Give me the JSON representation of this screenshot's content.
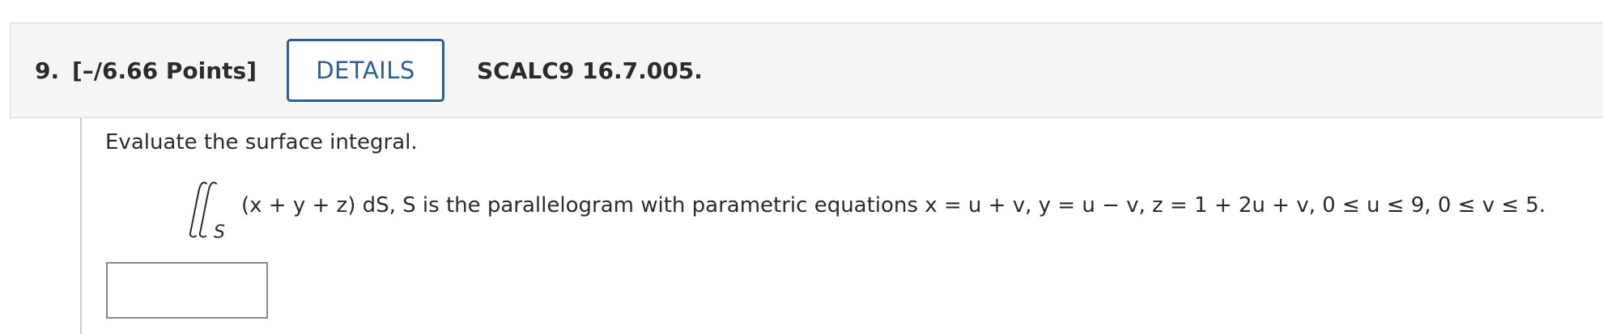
{
  "question": {
    "number": "9.",
    "points": "[–/6.66 Points]",
    "details_label": "DETAILS",
    "reference": "SCALC9 16.7.005.",
    "prompt": "Evaluate the surface integral.",
    "integral_subscript": "S",
    "equation_text": "(x + y + z) dS, S is the parallelogram with parametric equations x = u + v, y = u − v, z = 1 + 2u + v, 0 ≤ u ≤ 9, 0 ≤ v ≤ 5.",
    "answer_value": ""
  },
  "colors": {
    "header_bg": "#f5f5f5",
    "button_accent": "#2f5f8f",
    "text": "#2b2b2b"
  }
}
